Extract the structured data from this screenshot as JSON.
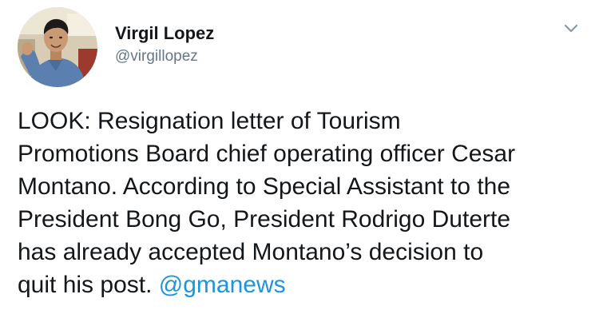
{
  "tweet": {
    "author": {
      "display_name": "Virgil Lopez",
      "handle": "@virgillopez"
    },
    "icons": {
      "avatar": "profile-photo",
      "menu": "chevron-down-icon"
    },
    "colors": {
      "text": "#14171a",
      "secondary": "#657786",
      "link": "#1b95e0",
      "caret": "#8899a6"
    },
    "text_lines": [
      "LOOK: Resignation letter of Tourism",
      "Promotions Board chief operating officer Cesar",
      "Montano. According to Special Assistant to the",
      "President Bong Go, President Rodrigo Duterte",
      "has already accepted Montano’s decision to",
      "quit his post. "
    ],
    "mention": "@gmanews"
  }
}
